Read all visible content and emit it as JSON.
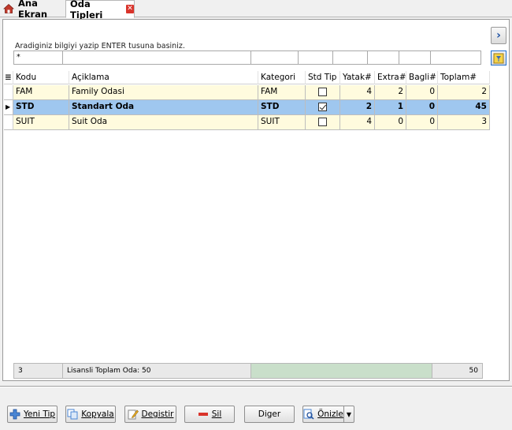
{
  "tabs": [
    {
      "label": "Ana Ekran",
      "icon": "home-icon"
    },
    {
      "label": "Oda Tipleri",
      "icon": "close-icon"
    }
  ],
  "search": {
    "label": "Aradiginiz bilgiyi yazip ENTER tusuna basiniz.",
    "filter_values": [
      "*",
      "",
      "",
      "",
      "",
      "",
      "",
      ""
    ]
  },
  "grid": {
    "columns": [
      "Kodu",
      "Açiklama",
      "Kategori",
      "Std Tip",
      "Yatak#",
      "Extra#",
      "Bagli#",
      "Toplam#"
    ],
    "rows": [
      {
        "kodu": "FAM",
        "aciklama": "Family Odasi",
        "kategori": "FAM",
        "std_tip": false,
        "yatak": "4",
        "extra": "2",
        "bagli": "0",
        "toplam": "2",
        "selected": false
      },
      {
        "kodu": "STD",
        "aciklama": "Standart Oda",
        "kategori": "STD",
        "std_tip": true,
        "yatak": "2",
        "extra": "1",
        "bagli": "0",
        "toplam": "45",
        "selected": true
      },
      {
        "kodu": "SUIT",
        "aciklama": "Suit Oda",
        "kategori": "SUIT",
        "std_tip": false,
        "yatak": "4",
        "extra": "0",
        "bagli": "0",
        "toplam": "3",
        "selected": false
      }
    ]
  },
  "footer": {
    "count": "3",
    "license_text": "Lisansli Toplam Oda: 50",
    "total": "50"
  },
  "buttons": {
    "new": "Yeni Tip",
    "copy": "Kopyala",
    "edit": "Degistir",
    "delete": "Sil",
    "other": "Diger",
    "preview": "Önizle"
  },
  "colors": {
    "selected_row": "#9fc7ef",
    "row_bg": "#fffbde",
    "footer_green": "#c9dfca"
  }
}
